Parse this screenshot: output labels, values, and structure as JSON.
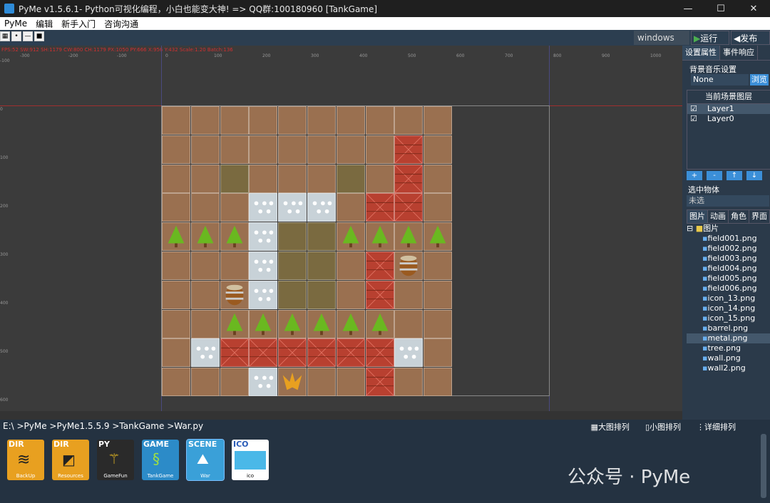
{
  "window": {
    "title": "PyMe v1.5.6.1- Python可视化编程，小白也能变大神!   => QQ群:100180960     [TankGame]",
    "minimize": "—",
    "maximize": "☐",
    "close": "✕"
  },
  "menu": [
    "PyMe",
    "编辑",
    "新手入门",
    "咨询沟通"
  ],
  "toolbar": {
    "icons": [
      "grid-icon",
      "dot-icon",
      "line-icon",
      "square-icon"
    ],
    "platform": "windows",
    "run_label": "运行",
    "publish_label": "发布"
  },
  "canvas": {
    "status": "FPS:52 SW:912 SH:1179 CW:800 CH:1179 PX:1050 PY:666 X:956 Y:432 Scale:1.20 Batch:136",
    "ruler_h": [
      "-300",
      "-200",
      "-100",
      "0",
      "100",
      "200",
      "300",
      "400",
      "500",
      "600",
      "700",
      "800",
      "900",
      "1000"
    ],
    "ruler_v": [
      "-100",
      "0",
      "100",
      "200",
      "300",
      "400",
      "500",
      "600"
    ]
  },
  "map": {
    "cols": 10,
    "rows": 10,
    "tiles": [
      [
        "dirt",
        "dirt",
        "dirt",
        "dirt",
        "dirt",
        "dirt",
        "dirt",
        "dirt",
        "dirt",
        "dirt"
      ],
      [
        "dirt",
        "dirt",
        "dirt",
        "dirt",
        "dirt",
        "dirt",
        "dirt",
        "dirt",
        "wall",
        "dirt"
      ],
      [
        "dirt",
        "dirt",
        "field",
        "dirt",
        "dirt",
        "dirt",
        "field",
        "dirt",
        "wall",
        "dirt"
      ],
      [
        "dirt",
        "dirt",
        "dirt",
        "metal",
        "metal",
        "metal",
        "dirt",
        "wall",
        "wall",
        "dirt"
      ],
      [
        "tree",
        "tree",
        "tree",
        "metal",
        "field",
        "field",
        "tree",
        "tree",
        "tree",
        "tree"
      ],
      [
        "dirt",
        "dirt",
        "dirt",
        "metal",
        "field",
        "field",
        "dirt",
        "wall",
        "barrel",
        "dirt"
      ],
      [
        "dirt",
        "dirt",
        "barrel",
        "metal",
        "field",
        "field",
        "dirt",
        "wall",
        "dirt",
        "dirt"
      ],
      [
        "dirt",
        "dirt",
        "tree",
        "tree",
        "tree",
        "tree",
        "tree",
        "tree",
        "dirt",
        "dirt"
      ],
      [
        "dirt",
        "metal",
        "wall",
        "wall",
        "wall",
        "wall",
        "wall",
        "wall",
        "metal",
        "dirt"
      ],
      [
        "dirt",
        "dirt",
        "dirt",
        "metal",
        "eagle",
        "dirt",
        "dirt",
        "wall",
        "dirt",
        "dirt"
      ]
    ],
    "colors": {
      "dirt": "#9a7050",
      "field": "#7a6a40",
      "metal": "#c8d2d8",
      "wall": "#b84030",
      "tree": "#9a7050",
      "barrel": "#9a7050",
      "eagle": "#9a7050"
    }
  },
  "right_panel": {
    "tabs": [
      "设置属性",
      "事件响应"
    ],
    "bgm_label": "背景音乐设置",
    "bgm_value": "None",
    "browse_label": "浏览",
    "layers_title": "当前场景图层",
    "layers": [
      {
        "check": "☑",
        "name": "Layer1"
      },
      {
        "check": "☑",
        "name": "Layer0"
      }
    ],
    "layer_buttons": [
      "+",
      "-",
      "↑",
      "↓"
    ],
    "selected_label": "选中物体",
    "selected_value": "未选",
    "resource_tabs": [
      "图片",
      "动画",
      "角色",
      "界面"
    ],
    "tree_root": "图片",
    "images": [
      "field001.png",
      "field002.png",
      "field003.png",
      "field004.png",
      "field005.png",
      "field006.png",
      "icon_13.png",
      "icon_14.png",
      "icon_15.png",
      "barrel.png",
      "metal.png",
      "tree.png",
      "wall.png",
      "wall2.png"
    ]
  },
  "bottom": {
    "path": "E:\\ >PyMe >PyMe1.5.5.9 >TankGame >War.py",
    "view_options": [
      "大图排列",
      "小图排列",
      "详细排列"
    ],
    "files": [
      {
        "type": "DIR",
        "name": "BackUp"
      },
      {
        "type": "DIR",
        "name": "Resources"
      },
      {
        "type": "PY",
        "name": "GameFun"
      },
      {
        "type": "GAME",
        "name": "TankGame"
      },
      {
        "type": "SCENE",
        "name": "War"
      },
      {
        "type": "ICO",
        "name": "ico"
      }
    ],
    "watermark": "公众号 · PyMe"
  }
}
